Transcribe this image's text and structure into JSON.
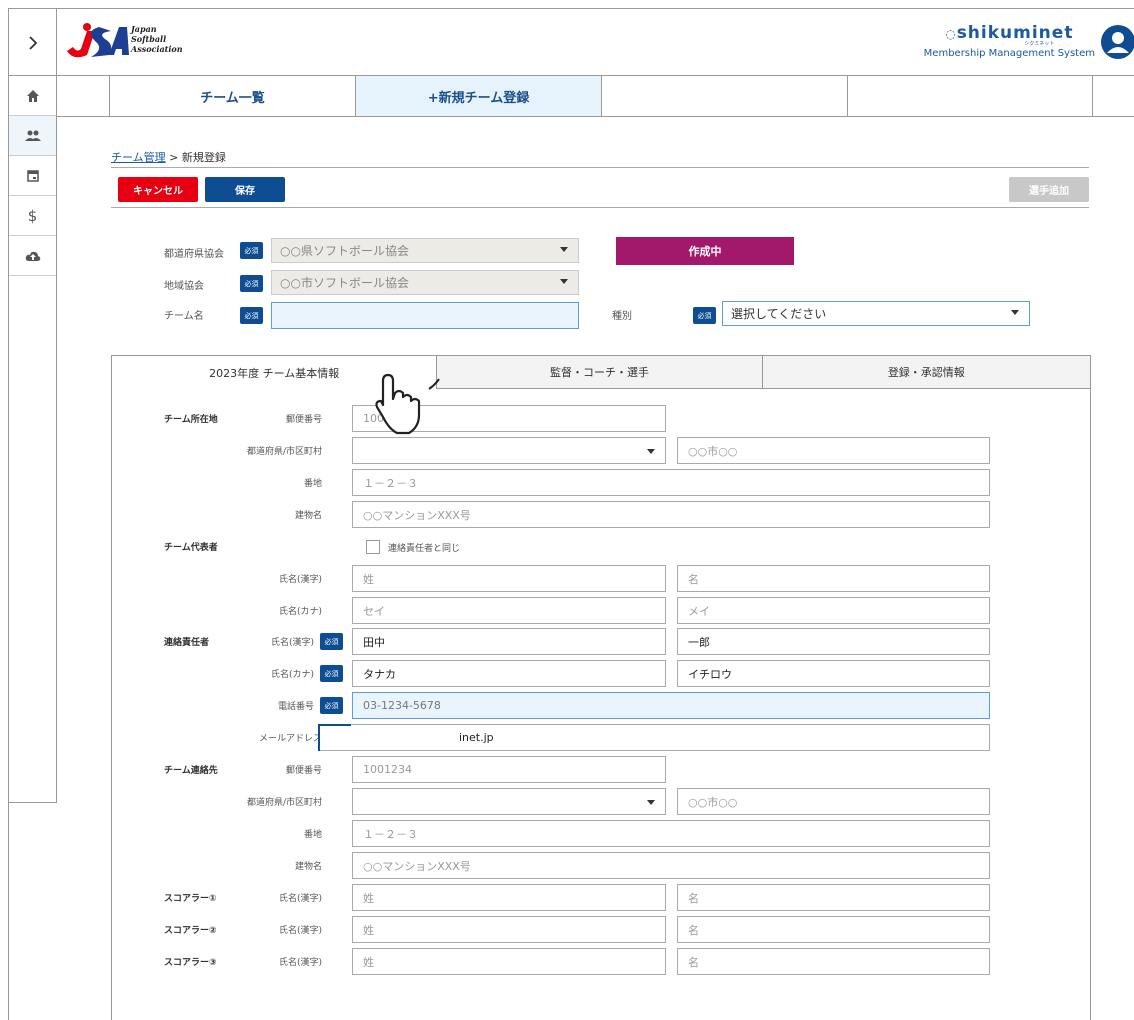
{
  "header": {
    "logo_lines": [
      "Japan",
      "Softball",
      "Association"
    ],
    "brand_name": "shikuminet",
    "brand_kana": "シクミネット",
    "brand_sub": "Membership Management System"
  },
  "sidebar": {
    "items": [
      {
        "icon": "home-icon"
      },
      {
        "icon": "team-icon"
      },
      {
        "icon": "calendar-icon"
      },
      {
        "icon": "dollar-icon",
        "glyph": "$"
      },
      {
        "icon": "cloud-upload-icon"
      }
    ]
  },
  "nav": {
    "tabs": [
      {
        "label": "チーム一覧"
      },
      {
        "label": "+新規チーム登録"
      },
      {
        "label": ""
      },
      {
        "label": ""
      }
    ]
  },
  "breadcrumb": {
    "link": "チーム管理",
    "sep": " > ",
    "current": "新規登録"
  },
  "toolbar": {
    "cancel_label": "キャンセル",
    "save_label": "保存",
    "add_player_label": "選手追加"
  },
  "required_label": "必須",
  "form_header": {
    "prefecture_label": "都道府県協会",
    "prefecture_value": "○○県ソフトボール協会",
    "region_label": "地域協会",
    "region_value": "○○市ソフトボール協会",
    "team_name_label": "チーム名",
    "team_name_value": "",
    "status": "作成中",
    "type_label": "種別",
    "type_value": "選択してください"
  },
  "panel_tabs": [
    {
      "label": "2023年度 チーム基本情報"
    },
    {
      "label": "監督・コーチ・選手"
    },
    {
      "label": "登録・承認情報"
    }
  ],
  "team_info": {
    "location_section": "チーム所在地",
    "postal_label": "郵便番号",
    "postal_value": "10012",
    "pref_city_label": "都道府県/市区町村",
    "city_placeholder": "○○市○○",
    "address_label": "番地",
    "address_placeholder": "１－２－３",
    "building_label": "建物名",
    "building_placeholder": "○○マンションXXX号",
    "rep_section": "チーム代表者",
    "same_as_contact": "連絡責任者と同じ",
    "name_kanji_label": "氏名(漢字)",
    "name_kana_label": "氏名(カナ)",
    "last_placeholder": "姓",
    "first_placeholder": "名",
    "last_kana_placeholder": "セイ",
    "first_kana_placeholder": "メイ",
    "contact_section": "連絡責任者",
    "contact_last": "田中",
    "contact_first": "一郎",
    "contact_last_kana": "タナカ",
    "contact_first_kana": "イチロウ",
    "phone_label": "電話番号",
    "phone_value": "03-1234-5678",
    "email_label": "メールアドレス",
    "email_value": "inet.jp",
    "team_contact_section": "チーム連絡先",
    "postal2_value": "1001234",
    "scorer1": "スコアラー①",
    "scorer2": "スコアラー②",
    "scorer3": "スコアラー③"
  }
}
